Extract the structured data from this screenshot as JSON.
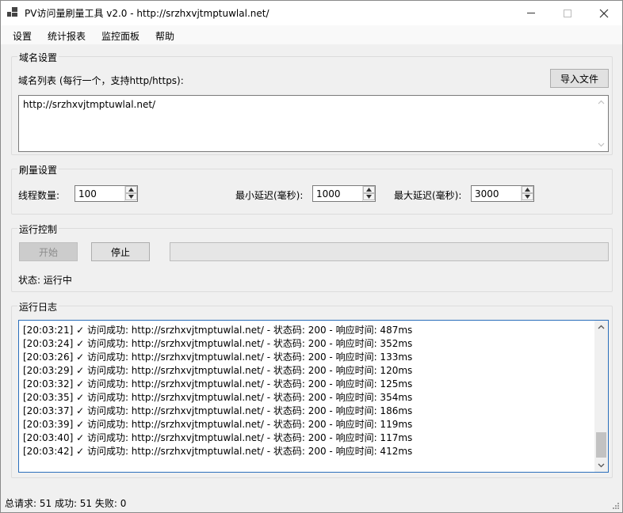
{
  "window": {
    "title": "PV访问量刷量工具 v2.0 - http://srzhxvjtmptuwlal.net/"
  },
  "menu": {
    "items": [
      "设置",
      "统计报表",
      "监控面板",
      "帮助"
    ]
  },
  "domain_settings": {
    "group_title": "域名设置",
    "list_label": "域名列表 (每行一个，支持http/https):",
    "import_button": "导入文件",
    "domains_text": "http://srzhxvjtmptuwlal.net/"
  },
  "boost_settings": {
    "group_title": "刷量设置",
    "threads_label": "线程数量:",
    "threads_value": "100",
    "min_delay_label": "最小延迟(毫秒):",
    "min_delay_value": "1000",
    "max_delay_label": "最大延迟(毫秒):",
    "max_delay_value": "3000"
  },
  "run_control": {
    "group_title": "运行控制",
    "start_button": "开始",
    "stop_button": "停止",
    "status_text": "状态: 运行中"
  },
  "log": {
    "group_title": "运行日志",
    "lines": [
      "[20:03:21] ✓ 访问成功: http://srzhxvjtmptuwlal.net/ - 状态码: 200 - 响应时间: 487ms",
      "[20:03:24] ✓ 访问成功: http://srzhxvjtmptuwlal.net/ - 状态码: 200 - 响应时间: 352ms",
      "[20:03:26] ✓ 访问成功: http://srzhxvjtmptuwlal.net/ - 状态码: 200 - 响应时间: 133ms",
      "[20:03:29] ✓ 访问成功: http://srzhxvjtmptuwlal.net/ - 状态码: 200 - 响应时间: 120ms",
      "[20:03:32] ✓ 访问成功: http://srzhxvjtmptuwlal.net/ - 状态码: 200 - 响应时间: 125ms",
      "[20:03:35] ✓ 访问成功: http://srzhxvjtmptuwlal.net/ - 状态码: 200 - 响应时间: 354ms",
      "[20:03:37] ✓ 访问成功: http://srzhxvjtmptuwlal.net/ - 状态码: 200 - 响应时间: 186ms",
      "[20:03:39] ✓ 访问成功: http://srzhxvjtmptuwlal.net/ - 状态码: 200 - 响应时间: 119ms",
      "[20:03:40] ✓ 访问成功: http://srzhxvjtmptuwlal.net/ - 状态码: 200 - 响应时间: 117ms",
      "[20:03:42] ✓ 访问成功: http://srzhxvjtmptuwlal.net/ - 状态码: 200 - 响应时间: 412ms"
    ]
  },
  "statusbar": {
    "text": "总请求: 51  成功: 51  失败: 0"
  },
  "icons": {
    "app": "app-icon",
    "minimize": "minimize-icon",
    "maximize": "maximize-icon",
    "close": "close-icon",
    "scroll_up": "chevron-up-icon",
    "scroll_down": "chevron-down-icon",
    "resize": "resize-grip-icon"
  },
  "colors": {
    "window_bg": "#f0f0f0",
    "titlebar_bg": "#ffffff",
    "disabled_button_bg": "#cccccc",
    "focus_border": "#2a6ebb"
  }
}
